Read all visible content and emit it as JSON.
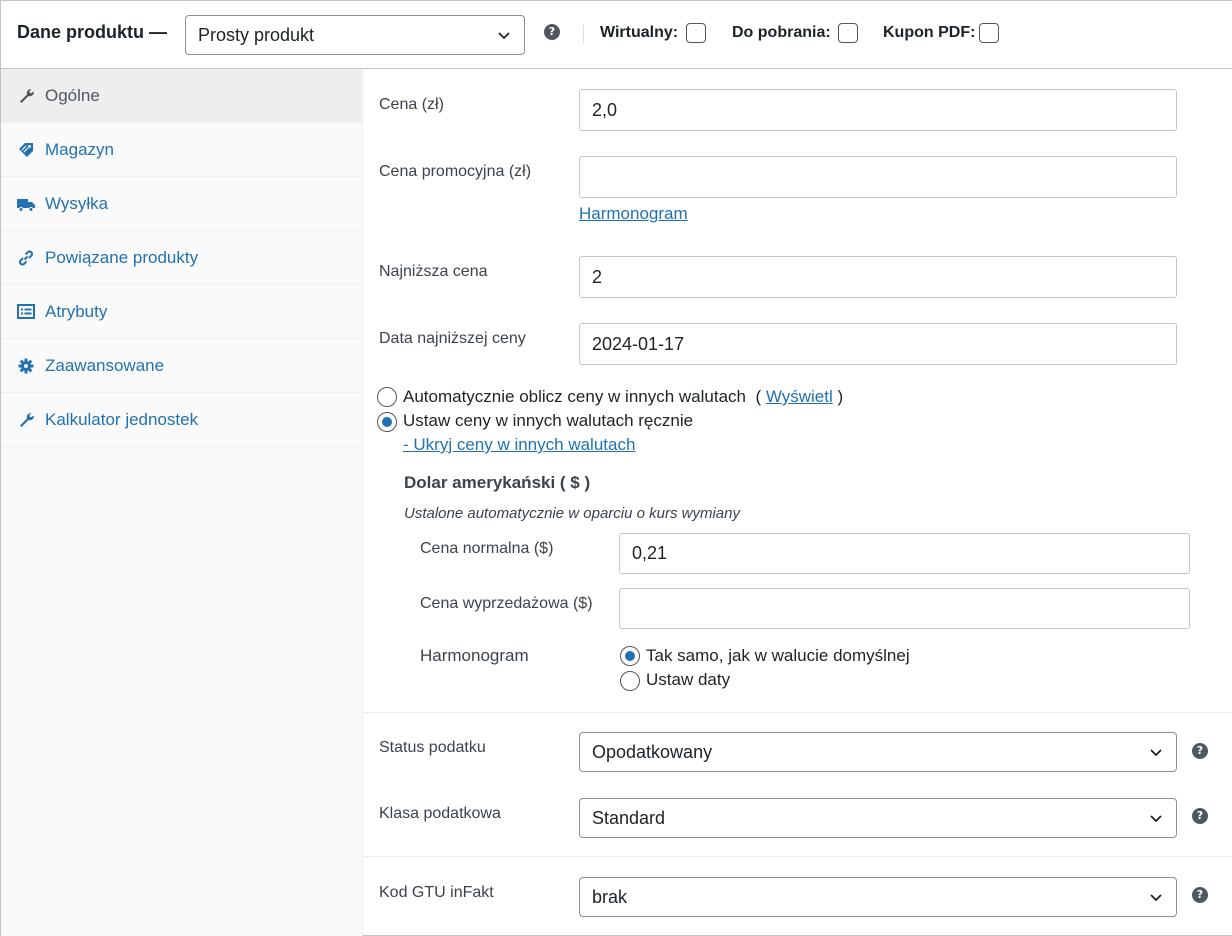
{
  "header": {
    "title": "Dane produktu —",
    "product_type": "Prosty produkt",
    "options": [
      {
        "label": "Wirtualny:",
        "checked": false
      },
      {
        "label": "Do pobrania:",
        "checked": false
      },
      {
        "label": "Kupon PDF:",
        "checked": false
      }
    ]
  },
  "sidebar": {
    "items": [
      {
        "label": "Ogólne",
        "icon": "wrench-icon",
        "active": true
      },
      {
        "label": "Magazyn",
        "icon": "tag-icon",
        "active": false
      },
      {
        "label": "Wysyłka",
        "icon": "truck-icon",
        "active": false
      },
      {
        "label": "Powiązane produkty",
        "icon": "link-icon",
        "active": false
      },
      {
        "label": "Atrybuty",
        "icon": "list-icon",
        "active": false
      },
      {
        "label": "Zaawansowane",
        "icon": "gear-icon",
        "active": false
      },
      {
        "label": "Kalkulator jednostek",
        "icon": "wrench-icon",
        "active": false
      }
    ]
  },
  "general": {
    "price_label": "Cena (zł)",
    "price_value": "2,0",
    "sale_price_label": "Cena promocyjna (zł)",
    "sale_price_value": "",
    "schedule_link": "Harmonogram",
    "lowest_price_label": "Najniższa cena",
    "lowest_price_value": "2",
    "lowest_date_label": "Data najniższej ceny",
    "lowest_date_value": "2024-01-17"
  },
  "currency": {
    "auto_option": "Automatycznie oblicz ceny w innych walutach",
    "auto_paren_open": "(",
    "auto_link": "Wyświetl",
    "auto_paren_close": ")",
    "manual_option": "Ustaw ceny w innych walutach ręcznie",
    "hide_link": "- Ukryj ceny w innych walutach",
    "selected": "manual",
    "usd": {
      "title": "Dolar amerykański ( $ )",
      "note": "Ustalone automatycznie w oparciu o kurs wymiany",
      "regular_label": "Cena normalna ($)",
      "regular_value": "0,21",
      "sale_label": "Cena wyprzedażowa ($)",
      "sale_value": "",
      "schedule_label": "Harmonogram",
      "schedule_same": "Tak samo, jak w walucie domyślnej",
      "schedule_set": "Ustaw daty",
      "schedule_selected": "same"
    }
  },
  "tax": {
    "status_label": "Status podatku",
    "status_value": "Opodatkowany",
    "class_label": "Klasa podatkowa",
    "class_value": "Standard"
  },
  "gtu": {
    "label": "Kod GTU inFakt",
    "value": "brak"
  },
  "colors": {
    "link": "#2271b1",
    "active_tab_bg": "#eeeeee",
    "border": "#c3c4c7"
  }
}
